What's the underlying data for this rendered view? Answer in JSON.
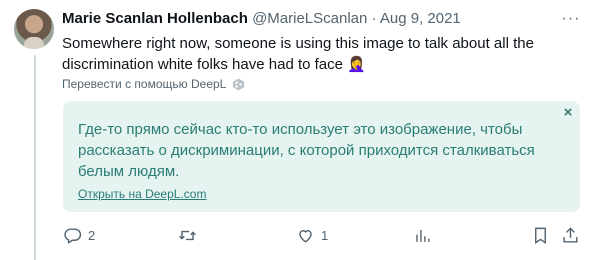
{
  "tweet": {
    "author_name": "Marie Scanlan Hollenbach",
    "handle": "@MarieLScanlan",
    "separator": "·",
    "date": "Aug 9, 2021",
    "text": "Somewhere right now, someone is using this image to talk about all the discrimination white folks have had to face 🤦‍♀️",
    "more_icon": "···"
  },
  "translation": {
    "translate_link": "Перевести с помощью DeepL",
    "translated_text": "Где-то прямо сейчас кто-то использует это изображение, чтобы рассказать о дискриминации, с которой приходится сталкиваться белым людям.",
    "open_link": "Открыть на DeepL.com",
    "close_icon": "×"
  },
  "actions": {
    "reply_count": "2",
    "like_count": "1"
  },
  "colors": {
    "text": "#0f1419",
    "muted": "#536471",
    "translation_bg": "#e6f4f1",
    "translation_text": "#2a7d74"
  }
}
